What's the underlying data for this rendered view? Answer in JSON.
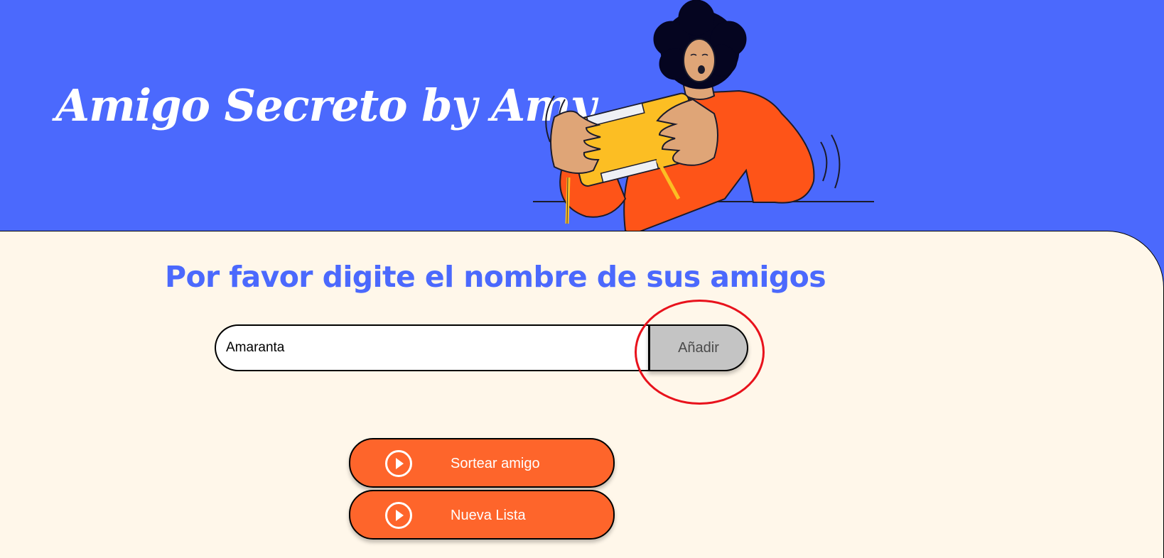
{
  "header": {
    "title": "Amigo Secreto by Amy"
  },
  "main": {
    "title": "Por favor digite el nombre de sus amigos",
    "input": {
      "value": "Amaranta",
      "placeholder": ""
    },
    "add_button_label": "Añadir",
    "draw_button_label": "Sortear amigo",
    "new_list_button_label": "Nueva Lista"
  },
  "icons": {
    "draw_button_icon": "play-circle-icon",
    "new_list_button_icon": "play-circle-icon",
    "hero_image": "person-shaking-gift-box-illustration"
  },
  "colors": {
    "header_bg": "#4b69fd",
    "main_bg": "#fff7ea",
    "title_blue": "#4b69fd",
    "orange_button": "#fe652b",
    "add_button_bg": "#c4c4c4",
    "annotation_ring": "#e8121c"
  }
}
